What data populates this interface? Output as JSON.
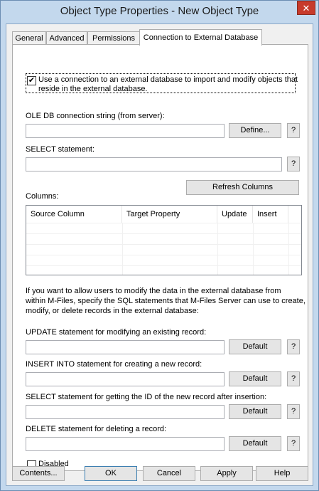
{
  "window": {
    "title": "Object Type Properties - New Object Type",
    "close_glyph": "✕"
  },
  "tabs": [
    {
      "label": "General"
    },
    {
      "label": "Advanced"
    },
    {
      "label": "Permissions"
    },
    {
      "label": "Connection to External Database"
    }
  ],
  "connection": {
    "use_external_label_line1": "Use a connection to an external database to import and modify objects that",
    "use_external_label_line2": "reside in the external database.",
    "use_external_checked": "✔",
    "ole_label": "OLE DB connection string (from server):",
    "ole_value": "",
    "define_label": "Define...",
    "select_label": "SELECT statement:",
    "select_value": "",
    "refresh_label": "Refresh Columns",
    "columns_label": "Columns:",
    "columns_headers": [
      "Source Column",
      "Target Property",
      "Update",
      "Insert"
    ],
    "info_line1": "If you want to allow users to modify the data in the external database from",
    "info_line2": "within M-Files, specify the SQL statements that M-Files Server can use to create,",
    "info_line3": "modify, or delete records in the external database:",
    "update_label": "UPDATE statement for modifying an existing record:",
    "insert_label": "INSERT INTO statement for creating a new record:",
    "select_id_label": "SELECT statement for getting the ID of the new record after insertion:",
    "delete_label": "DELETE statement for deleting a record:",
    "default_label": "Default",
    "help_label": "?",
    "disabled_label": "Disabled"
  },
  "footer": {
    "contents": "Contents...",
    "ok": "OK",
    "cancel": "Cancel",
    "apply": "Apply",
    "help": "Help"
  }
}
